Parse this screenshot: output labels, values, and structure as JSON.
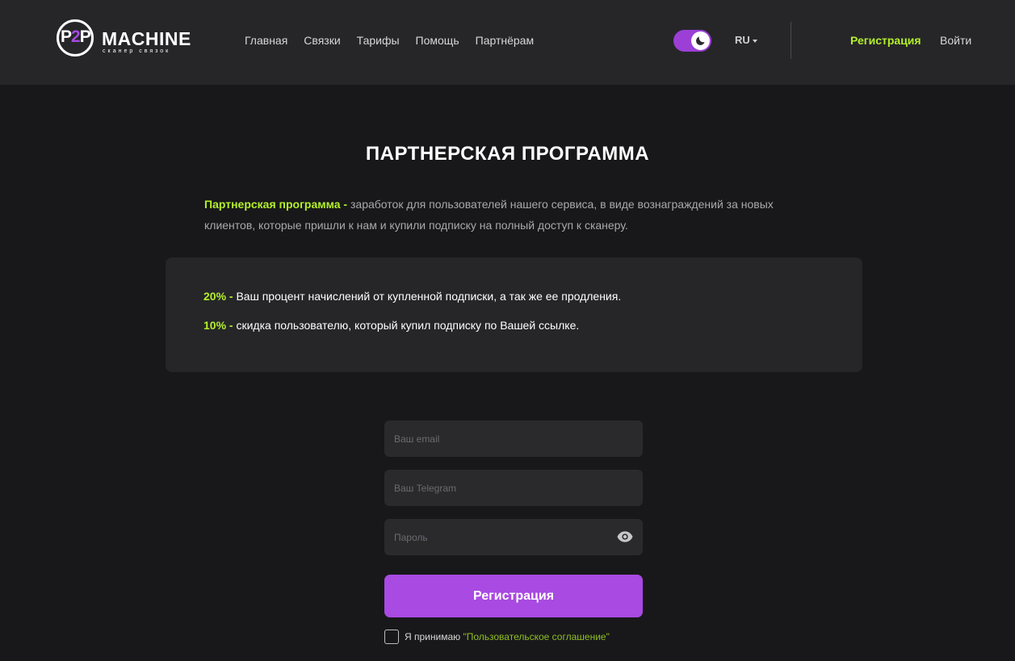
{
  "header": {
    "logo": {
      "mark_left": "P",
      "mark_mid": "2",
      "mark_right": "P",
      "word": "MACHINE",
      "tagline": "сканер связок"
    },
    "nav": [
      {
        "label": "Главная"
      },
      {
        "label": "Связки"
      },
      {
        "label": "Тарифы"
      },
      {
        "label": "Помощь"
      },
      {
        "label": "Партнёрам"
      }
    ],
    "theme_toggle": {
      "state": "dark",
      "icon": "moon-icon"
    },
    "language": "RU",
    "register_link": "Регистрация",
    "login_link": "Войти"
  },
  "main": {
    "title": "ПАРТНЕРСКАЯ ПРОГРАММА",
    "intro": {
      "highlight": "Партнерская программа -",
      "text": " заработок для пользователей нашего сервиса, в виде вознаграждений за новых клиентов, которые пришли к нам и купили подписку на полный доступ к сканеру."
    },
    "info": [
      {
        "highlight": "20% -",
        "text": " Ваш процент начислений от купленной подписки, а так же ее продления."
      },
      {
        "highlight": "10% -",
        "text": " скидка пользователю, который купил подписку по Вашей ссылке."
      }
    ]
  },
  "form": {
    "email": {
      "value": "",
      "placeholder": "Ваш email"
    },
    "telegram": {
      "value": "",
      "placeholder": "Ваш Telegram"
    },
    "password": {
      "value": "",
      "placeholder": "Пароль",
      "icon": "eye-icon"
    },
    "submit_label": "Регистрация",
    "agree": {
      "checked": false,
      "text": "Я принимаю ",
      "link": "\"Пользовательское соглашение\""
    }
  },
  "colors": {
    "background": "#18181a",
    "header": "#262629",
    "accent_green": "#b4f02a",
    "accent_purple": "#a94ae2"
  }
}
